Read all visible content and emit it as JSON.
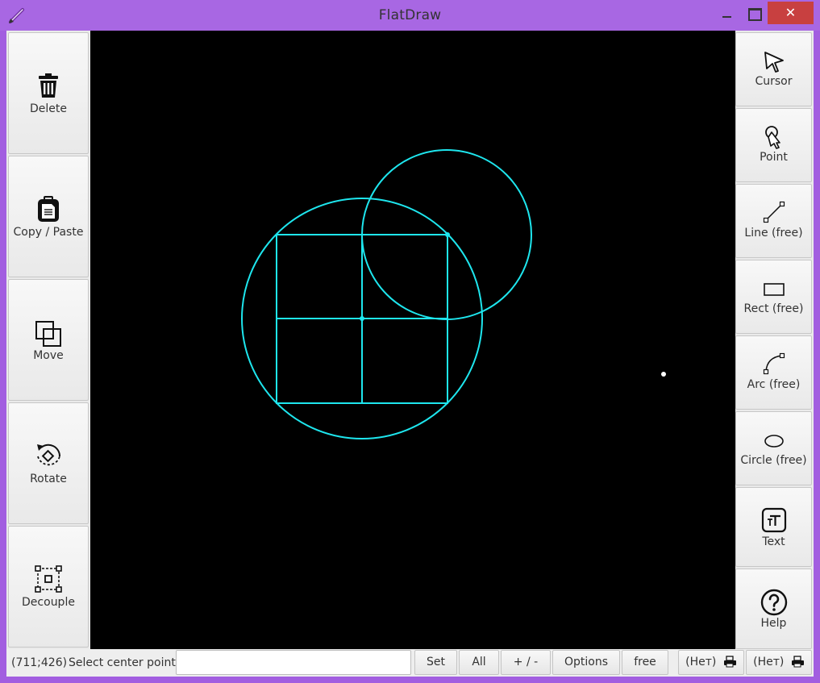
{
  "window": {
    "title": "FlatDraw",
    "close_glyph": "✕",
    "colors": {
      "titlebar": "#a867e3",
      "close": "#c84040",
      "canvas": "#000000",
      "shapes": "#1ee6ee"
    }
  },
  "left_toolbar": {
    "items": [
      {
        "label": "Delete",
        "icon": "trash-icon"
      },
      {
        "label": "Copy / Paste",
        "icon": "clipboard-icon"
      },
      {
        "label": "Move",
        "icon": "move-squares-icon"
      },
      {
        "label": "Rotate",
        "icon": "rotate-icon"
      },
      {
        "label": "Decouple",
        "icon": "decouple-icon"
      }
    ]
  },
  "right_toolbar": {
    "items": [
      {
        "label": "Cursor",
        "icon": "cursor-arrow-icon"
      },
      {
        "label": "Point",
        "icon": "point-pin-icon"
      },
      {
        "label": "Line (free)",
        "icon": "line-icon"
      },
      {
        "label": "Rect (free)",
        "icon": "rectangle-icon"
      },
      {
        "label": "Arc (free)",
        "icon": "arc-icon"
      },
      {
        "label": "Circle (free)",
        "icon": "ellipse-icon"
      },
      {
        "label": "Text",
        "icon": "text-icon"
      },
      {
        "label": "Help",
        "icon": "help-question-icon"
      }
    ]
  },
  "statusbar": {
    "coordinates": "(711;426)",
    "message": "Select center point",
    "input_value": "",
    "buttons": {
      "set": "Set",
      "all": "All",
      "plus_minus": "+ / -",
      "options": "Options",
      "free": "free",
      "layer1": "(Нет)",
      "layer2": "(Нет)"
    }
  }
}
